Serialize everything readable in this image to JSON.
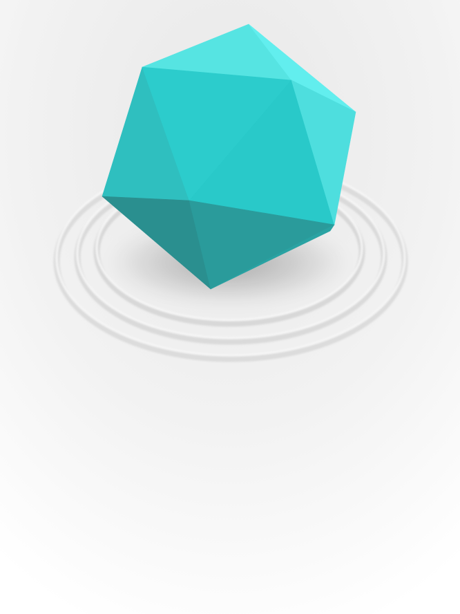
{
  "scene": {
    "object": "icosahedron",
    "rings": 3,
    "colors": {
      "background_top": "#e8e8e8",
      "background_bottom": "#ffffff",
      "ring_stroke": "#dcdcdc",
      "ring_highlight": "#f5f5f5",
      "shadow": "#000000",
      "face_top_left": "#56e4e2",
      "face_top_right": "#62eeee",
      "face_left_upper": "#2fbfbf",
      "face_center_upper": "#2ccccc",
      "face_center_right": "#29c9c9",
      "face_right": "#4edede",
      "face_right_lower": "#32d1d1",
      "face_left_lower": "#2a8f8f",
      "face_bottom_center": "#2a9b9b",
      "face_bottom_right": "#2aa3a3"
    }
  }
}
